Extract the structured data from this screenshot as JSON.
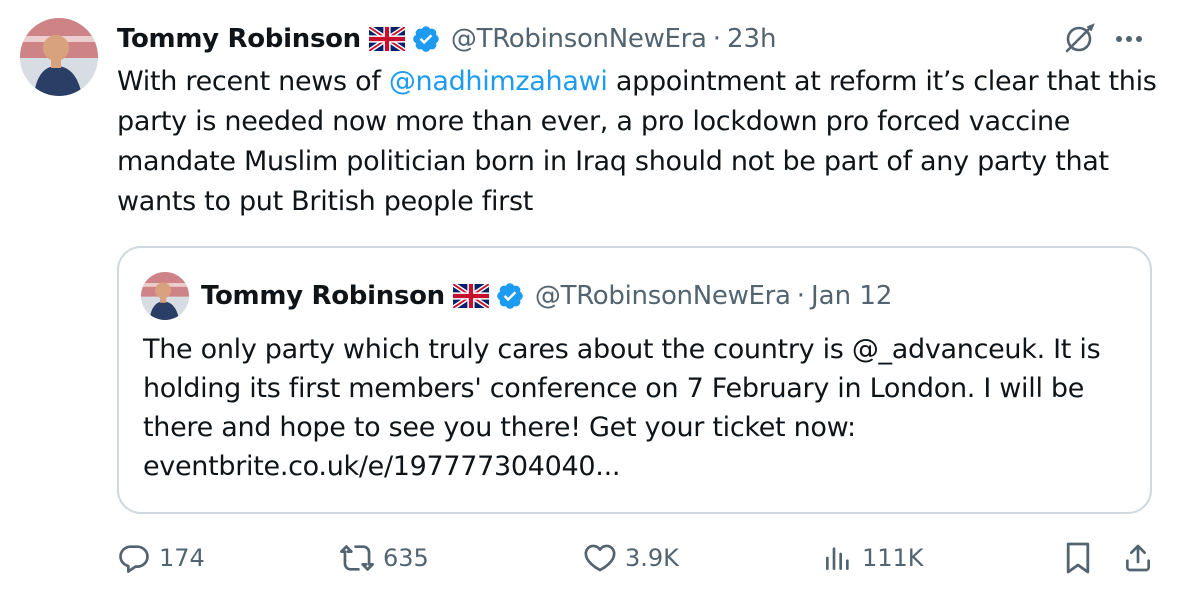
{
  "tweet": {
    "author": {
      "name": "Tommy Robinson",
      "handle": "@TRobinsonNewEra",
      "time": "23h",
      "flag_icon": "uk-flag-icon",
      "verified_icon": "verified-badge-icon"
    },
    "text": {
      "before": "With recent news of ",
      "mention": "@nadhimzahawi",
      "after": " appointment at reform it’s clear that this party is needed now more than ever, a pro lockdown pro forced vaccine mandate Muslim politician born in Iraq should not be part of any party that wants to put British people first"
    },
    "colors": {
      "mention": "#1d9bf0",
      "secondary_text": "#536471",
      "border": "#cfd9de",
      "verified": "#1d9bf0"
    }
  },
  "quote": {
    "author": {
      "name": "Tommy Robinson",
      "handle": "@TRobinsonNewEra",
      "date": "Jan 12"
    },
    "text": "The only party which truly cares about the country is @_advanceuk. It is holding its first members' conference on 7 February in London. I will be there and hope to see you there! Get your ticket now: eventbrite.co.uk/e/197777304040..."
  },
  "actions": {
    "replies": "174",
    "reposts": "635",
    "likes": "3.9K",
    "views": "111K"
  },
  "separator": "·"
}
